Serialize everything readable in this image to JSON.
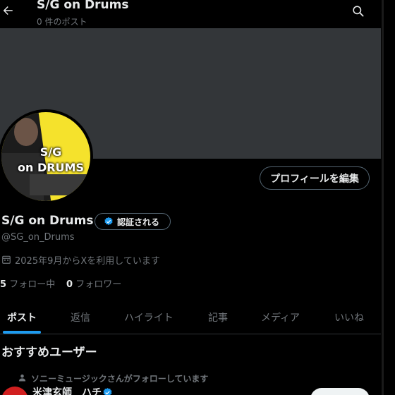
{
  "header": {
    "title": "S/G on Drums",
    "post_count": "0 件のポスト"
  },
  "profile": {
    "avatar_text_line1": "S/G",
    "avatar_text_line2": "on DRUMS",
    "edit_profile_label": "プロフィールを編集",
    "display_name": "S/G on Drums",
    "verify_label": "認証される",
    "handle": "@SG_on_Drums",
    "joined": "2025年9月からXを利用しています",
    "following_count": "5",
    "following_label": "フォロー中",
    "followers_count": "0",
    "followers_label": "フォロワー"
  },
  "tabs": [
    {
      "label": "ポスト"
    },
    {
      "label": "返信"
    },
    {
      "label": "ハイライト"
    },
    {
      "label": "記事"
    },
    {
      "label": "メディア"
    },
    {
      "label": "いいね"
    }
  ],
  "recommendations": {
    "title": "おすすめユーザー",
    "context": "ソニーミュージックさんがフォローしています",
    "user_name": "米津玄師　ハチ"
  },
  "colors": {
    "accent": "#1d9bf0",
    "background": "#000000",
    "banner": "#333639",
    "muted_text": "#71767b"
  },
  "icons": [
    "back-arrow-icon",
    "search-icon",
    "verified-badge-icon",
    "calendar-icon",
    "person-icon"
  ]
}
